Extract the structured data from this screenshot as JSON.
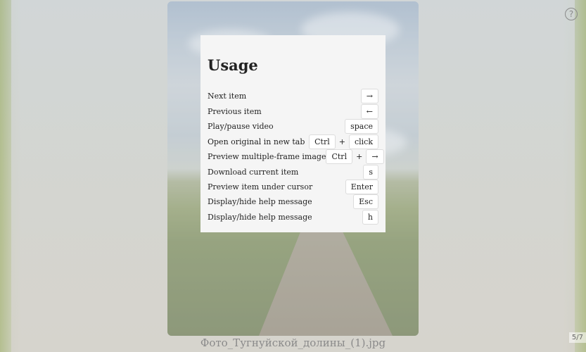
{
  "help": {
    "title": "Usage",
    "rows": [
      {
        "desc": "Next item",
        "keys": [
          "→"
        ]
      },
      {
        "desc": "Previous item",
        "keys": [
          "←"
        ]
      },
      {
        "desc": "Play/pause video",
        "keys": [
          "space"
        ]
      },
      {
        "desc": "Open original in new tab",
        "keys": [
          "Ctrl",
          "+",
          "click"
        ]
      },
      {
        "desc": "Preview multiple-frame image",
        "keys": [
          "Ctrl",
          "+",
          "→"
        ]
      },
      {
        "desc": "Download current item",
        "keys": [
          "s"
        ]
      },
      {
        "desc": "Preview item under cursor",
        "keys": [
          "Enter"
        ]
      },
      {
        "desc": "Display/hide help message",
        "keys": [
          "Esc"
        ]
      },
      {
        "desc": "Display/hide help message",
        "keys": [
          "h"
        ]
      }
    ]
  },
  "viewer": {
    "caption": "Фото_Тугнуйской_долины_(1).jpg",
    "counter": "5/7",
    "help_icon": "?",
    "help_icon_name": "question-circle-icon"
  }
}
